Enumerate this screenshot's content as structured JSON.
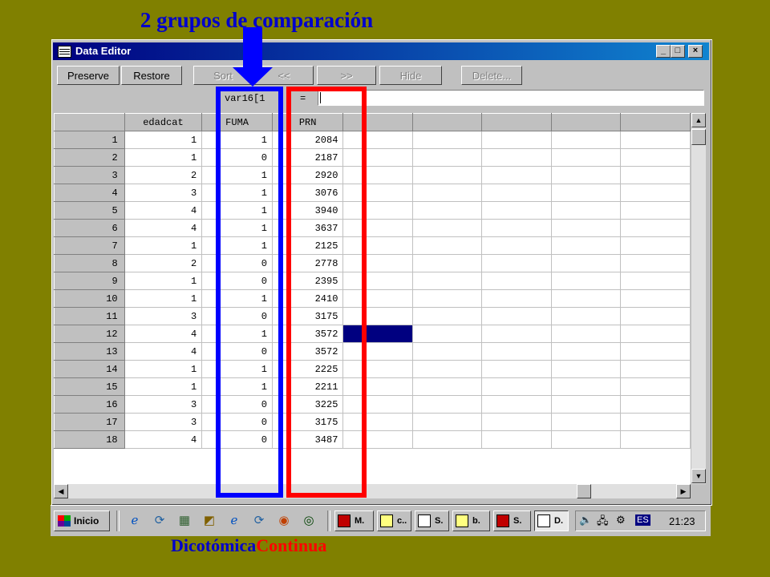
{
  "slide": {
    "title": "2 grupos de comparación",
    "caption_a": "Dicotómica",
    "caption_b": "Continua",
    "colors": {
      "background": "#808000",
      "title": "#0000cc",
      "arrow": "#0000ff",
      "box_a": "#0000ff",
      "box_b": "#ff0000"
    }
  },
  "window": {
    "title": "Data Editor",
    "icon": "grid-icon",
    "controls": {
      "minimize": "_",
      "maximize": "□",
      "close": "×"
    }
  },
  "toolbar": {
    "preserve": "Preserve",
    "restore": "Restore",
    "sort": "Sort",
    "prev": "<<",
    "next": ">>",
    "hide": "Hide",
    "delete": "Delete..."
  },
  "editbar": {
    "cell_ref": "var16[1",
    "equals": "=",
    "value": ""
  },
  "table": {
    "columns": [
      "edadcat",
      "FUMA",
      "PRN",
      "",
      "",
      "",
      "",
      ""
    ],
    "rows": [
      {
        "n": "1",
        "edadcat": "1",
        "fuma": "1",
        "prn": "2084"
      },
      {
        "n": "2",
        "edadcat": "1",
        "fuma": "0",
        "prn": "2187"
      },
      {
        "n": "3",
        "edadcat": "2",
        "fuma": "1",
        "prn": "2920"
      },
      {
        "n": "4",
        "edadcat": "3",
        "fuma": "1",
        "prn": "3076"
      },
      {
        "n": "5",
        "edadcat": "4",
        "fuma": "1",
        "prn": "3940"
      },
      {
        "n": "6",
        "edadcat": "4",
        "fuma": "1",
        "prn": "3637"
      },
      {
        "n": "7",
        "edadcat": "1",
        "fuma": "1",
        "prn": "2125"
      },
      {
        "n": "8",
        "edadcat": "2",
        "fuma": "0",
        "prn": "2778"
      },
      {
        "n": "9",
        "edadcat": "1",
        "fuma": "0",
        "prn": "2395"
      },
      {
        "n": "10",
        "edadcat": "1",
        "fuma": "1",
        "prn": "2410"
      },
      {
        "n": "11",
        "edadcat": "3",
        "fuma": "0",
        "prn": "3175"
      },
      {
        "n": "12",
        "edadcat": "4",
        "fuma": "1",
        "prn": "3572"
      },
      {
        "n": "13",
        "edadcat": "4",
        "fuma": "0",
        "prn": "3572"
      },
      {
        "n": "14",
        "edadcat": "1",
        "fuma": "1",
        "prn": "2225"
      },
      {
        "n": "15",
        "edadcat": "1",
        "fuma": "1",
        "prn": "2211"
      },
      {
        "n": "16",
        "edadcat": "3",
        "fuma": "0",
        "prn": "3225"
      },
      {
        "n": "17",
        "edadcat": "3",
        "fuma": "0",
        "prn": "3175"
      },
      {
        "n": "18",
        "edadcat": "4",
        "fuma": "0",
        "prn": "3487"
      }
    ],
    "selected_row": "12"
  },
  "taskbar": {
    "start": "Inicio",
    "quick_launch": [
      "ie-icon",
      "refresh-icon",
      "calendar-icon",
      "chart-icon",
      "ie-icon",
      "refresh-icon",
      "globe-icon",
      "media-icon"
    ],
    "tasks": [
      {
        "label": "M.",
        "icon": "powerpoint-icon",
        "color": "#c00000"
      },
      {
        "label": "c..",
        "icon": "folder-icon",
        "color": "#ffff80"
      },
      {
        "label": "S.",
        "icon": "word-icon",
        "color": "#ffffff"
      },
      {
        "label": "b.",
        "icon": "folder-icon",
        "color": "#ffff80"
      },
      {
        "label": "S.",
        "icon": "spss-icon",
        "color": "#c00000"
      },
      {
        "label": "D.",
        "icon": "data-editor-icon",
        "color": "#ffffff"
      }
    ],
    "tray": {
      "language": "ES",
      "time": "21:23"
    }
  }
}
